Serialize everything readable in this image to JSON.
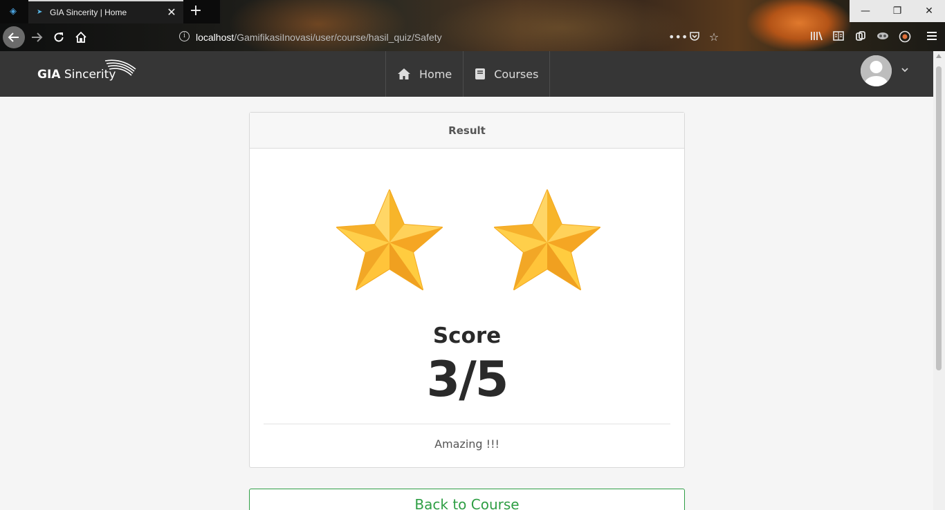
{
  "browser": {
    "tab_title": "GIA Sincerity | Home",
    "tab_close": "✕",
    "new_tab": "+",
    "url_host": "localhost",
    "url_path": "/GamifikasiInovasi/user/course/hasil_quiz/Safety",
    "icons": [
      "back-arrow-icon",
      "forward-arrow-icon",
      "reload-icon",
      "home-icon",
      "info-icon",
      "more-icon",
      "pocket-icon",
      "bookmark-star-icon",
      "library-icon",
      "reader-view-icon",
      "sync-icon",
      "extension-icon",
      "account-icon",
      "menu-icon"
    ],
    "window_controls": {
      "minimize": "—",
      "restore": "❐",
      "close": "✕"
    }
  },
  "site": {
    "brand_bold": "GIA",
    "brand_rest": " Sincerity",
    "nav": [
      {
        "label": "Home",
        "icon": "home-icon"
      },
      {
        "label": "Courses",
        "icon": "book-icon"
      }
    ],
    "user_caret": "⌄"
  },
  "result": {
    "header": "Result",
    "stars_earned": 2,
    "score_label": "Score",
    "score_value": "3/5",
    "message": "Amazing !!!",
    "back_button": "Back to Course"
  },
  "colors": {
    "navbar": "#363636",
    "star_light": "#ffcf4a",
    "star_dark": "#f5a623",
    "button_green": "#2e9e44"
  }
}
